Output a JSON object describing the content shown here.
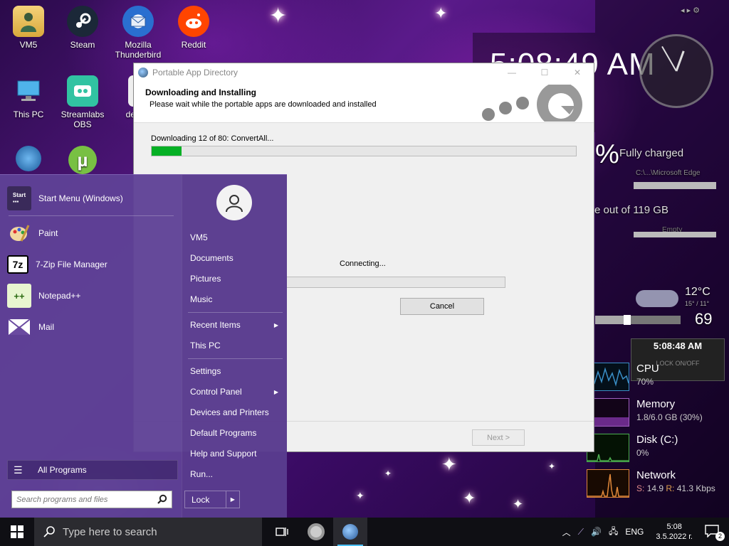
{
  "desktop": {
    "icons": [
      {
        "label": "VM5",
        "icon": "user-folder-icon"
      },
      {
        "label": "Steam",
        "icon": "steam-icon"
      },
      {
        "label": "Mozilla Thunderbird",
        "icon": "thunderbird-icon"
      },
      {
        "label": "Reddit",
        "icon": "reddit-icon"
      },
      {
        "label": "This PC",
        "icon": "computer-icon"
      },
      {
        "label": "Streamlabs OBS",
        "icon": "streamlabs-icon"
      },
      {
        "label": "de",
        "icon": "document-icon"
      }
    ]
  },
  "widgets": {
    "digital_time": "5:08:49 AM",
    "battery_status": "Fully charged",
    "battery_percent_fragment": "%",
    "browser_label": "C:\\...\\Microsoft Edge",
    "disk_free": "e out of 119 GB",
    "empty_label": "Empty",
    "weather_temp": "12°C",
    "weather_range": "15° / 11°",
    "volume": "69",
    "small_clock": "5:08:48 AM",
    "lock_label": "LOCK ON/OFF",
    "perf": [
      {
        "name": "CPU",
        "value": "70%",
        "color": "#3a8fc7"
      },
      {
        "name": "Memory",
        "value": "1.8/6.0 GB (30%)",
        "color": "#c080e0"
      },
      {
        "name": "Disk (C:)",
        "value": "0%",
        "color": "#4caf50"
      },
      {
        "name": "Network",
        "value_s_label": "S:",
        "value_s": "14.9",
        "value_r_label": "R:",
        "value_r": "41.3 Kbps",
        "color": "#e0883a"
      }
    ]
  },
  "dialog": {
    "title": "Portable App Directory",
    "header_title": "Downloading and Installing",
    "header_subtitle": "Please wait while the portable apps are downloaded and installed",
    "status": "Downloading 12 of 80: ConvertAll...",
    "overall_progress": 0.07,
    "connecting_text": "Connecting...",
    "connecting_progress": 0,
    "cancel_label": "Cancel",
    "next_label": "Next >"
  },
  "start_menu": {
    "pinned": [
      {
        "label": "Start Menu (Windows)",
        "icon": "start-menu-icon"
      },
      {
        "label": "Paint",
        "icon": "paint-icon"
      },
      {
        "label": "7-Zip File Manager",
        "icon": "7zip-icon"
      },
      {
        "label": "Notepad++",
        "icon": "notepadpp-icon"
      },
      {
        "label": "Mail",
        "icon": "mail-icon"
      }
    ],
    "all_programs_label": "All Programs",
    "search_placeholder": "Search programs and files",
    "right_items": [
      {
        "label": "VM5"
      },
      {
        "label": "Documents"
      },
      {
        "label": "Pictures"
      },
      {
        "label": "Music"
      },
      {
        "label": "Recent Items",
        "has_arrow": true
      },
      {
        "label": "This PC"
      },
      {
        "label": "Settings"
      },
      {
        "label": "Control Panel",
        "has_arrow": true
      },
      {
        "label": "Devices and Printers"
      },
      {
        "label": "Default Programs"
      },
      {
        "label": "Help and Support"
      },
      {
        "label": "Run..."
      }
    ],
    "lock_label": "Lock"
  },
  "taskbar": {
    "search_placeholder": "Type here to search",
    "language": "ENG",
    "time": "5:08",
    "date": "3.5.2022 г.",
    "notification_count": "2"
  }
}
